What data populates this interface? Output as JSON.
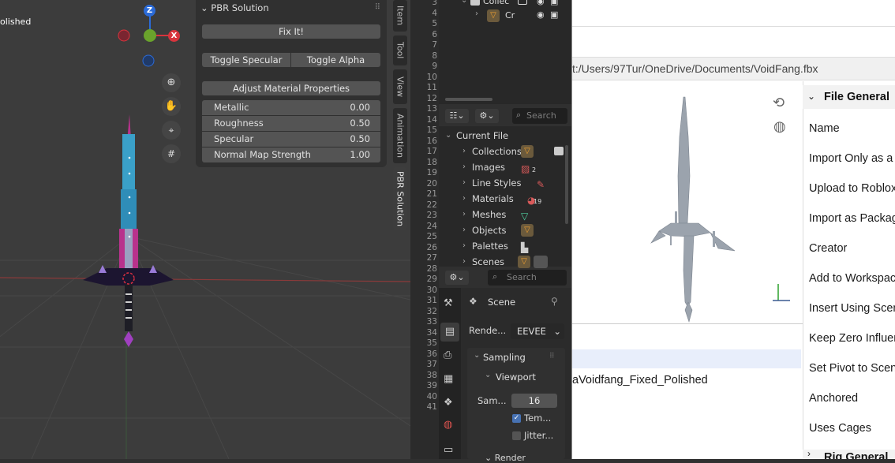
{
  "viewport": {
    "object_title": "olished"
  },
  "navigation": {
    "axis_z": "Z",
    "axis_x": "X"
  },
  "pbr": {
    "title": "PBR Solution",
    "fix_label": "Fix It!",
    "toggle_specular": "Toggle Specular",
    "toggle_alpha": "Toggle Alpha",
    "adjust_label": "Adjust Material Properties",
    "props": [
      {
        "label": "Metallic",
        "value": "0.00"
      },
      {
        "label": "Roughness",
        "value": "0.50"
      },
      {
        "label": "Specular",
        "value": "0.50"
      },
      {
        "label": "Normal Map Strength",
        "value": "1.00"
      }
    ]
  },
  "side_tabs": [
    "Item",
    "Tool",
    "View",
    "Animation",
    "PBR Solution"
  ],
  "line_numbers": [
    "3",
    "4",
    "5",
    "6",
    "7",
    "8",
    "9",
    "10",
    "11",
    "12",
    "13",
    "14",
    "15",
    "16",
    "17",
    "18",
    "19",
    "20",
    "21",
    "22",
    "23",
    "24",
    "25",
    "26",
    "27",
    "28",
    "29",
    "30",
    "31",
    "32",
    "33",
    "34",
    "35",
    "36",
    "37",
    "38",
    "39",
    "40",
    "41"
  ],
  "outliner": {
    "collection": "Collec",
    "child": "Cr"
  },
  "blendfile": {
    "search_placeholder": "Search",
    "root": "Current File",
    "items": [
      {
        "label": "Collections",
        "badge": ""
      },
      {
        "label": "Images",
        "badge": "2"
      },
      {
        "label": "Line Styles",
        "badge": ""
      },
      {
        "label": "Materials",
        "badge": "19"
      },
      {
        "label": "Meshes",
        "badge": ""
      },
      {
        "label": "Objects",
        "badge": ""
      },
      {
        "label": "Palettes",
        "badge": ""
      },
      {
        "label": "Scenes",
        "badge": ""
      }
    ]
  },
  "properties": {
    "search_placeholder": "Search",
    "scene_label": "Scene",
    "render_label": "Rende...",
    "render_engine": "EEVEE",
    "sampling": "Sampling",
    "viewport": "Viewport",
    "samples_label": "Sam...",
    "samples_value": "16",
    "temporal_label": "Tem...",
    "jitter_label": "Jitter...",
    "render_sub": "Render"
  },
  "dialog": {
    "path": "t:/Users/97Tur/OneDrive/Documents/VoidFang.fbx",
    "file_name": "aVoidfang_Fixed_Polished",
    "section": "File General",
    "options": [
      "Name",
      "Import Only as a M",
      "Upload to Roblox",
      "Import as Packag",
      "Creator",
      "Add to Workspace",
      "Insert Using Scen",
      "Keep Zero Influen",
      "Set Pivot to Scene",
      "Anchored",
      "Uses Cages"
    ],
    "next_section": "Rig General"
  }
}
